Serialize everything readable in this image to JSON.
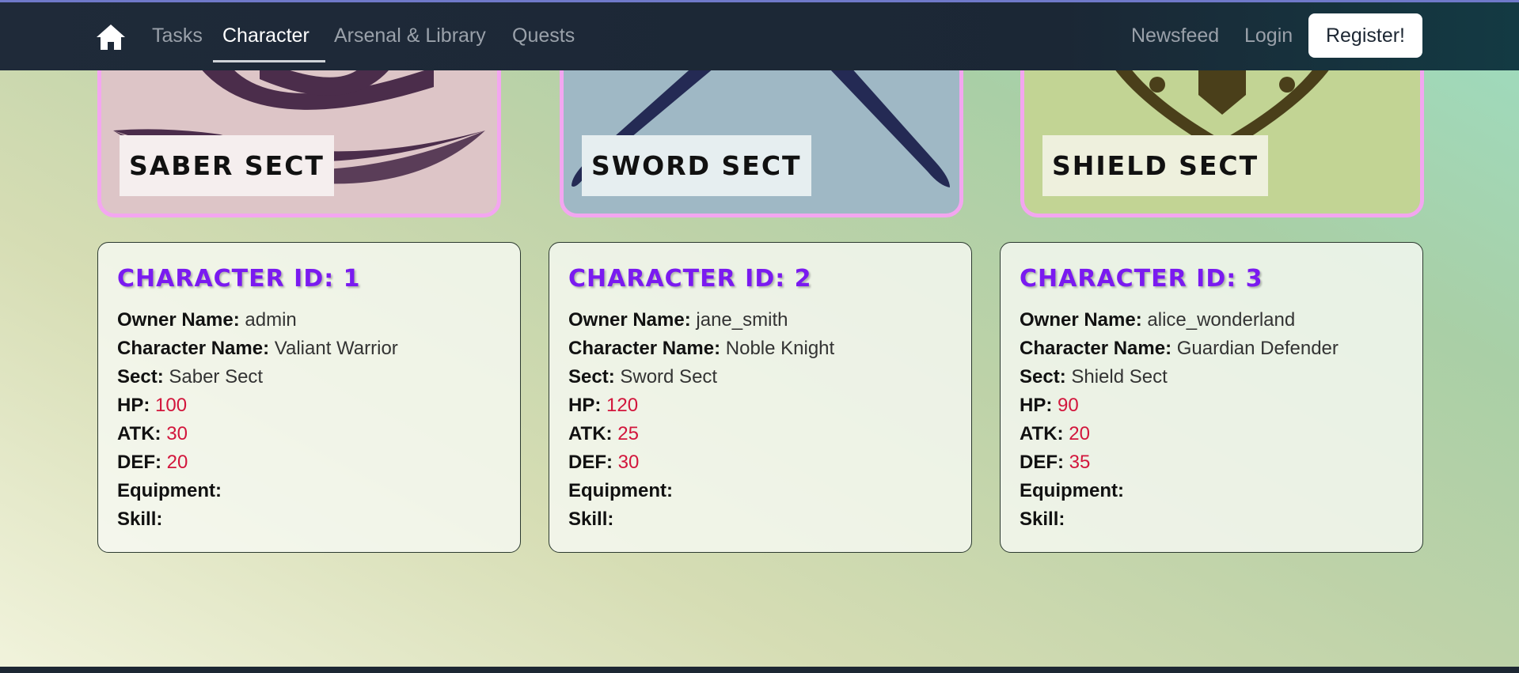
{
  "nav": {
    "home_icon": "home-icon",
    "links": [
      "Tasks",
      "Character",
      "Arsenal & Library",
      "Quests"
    ],
    "active": "Character",
    "right_links": [
      "Newsfeed",
      "Login"
    ],
    "register_label": "Register!"
  },
  "sects": [
    {
      "label": "SABER SECT",
      "icon": "crossed-sabers-icon"
    },
    {
      "label": "SWORD SECT",
      "icon": "crossed-swords-icon"
    },
    {
      "label": "SHIELD SECT",
      "icon": "shield-icon"
    }
  ],
  "characters": [
    {
      "title": "CHARACTER ID: 1",
      "owner_label": "Owner Name:",
      "owner": "admin",
      "name_label": "Character Name:",
      "name": "Valiant Warrior",
      "sect_label": "Sect:",
      "sect": "Saber Sect",
      "hp_label": "HP:",
      "hp": "100",
      "atk_label": "ATK:",
      "atk": "30",
      "def_label": "DEF:",
      "def": "20",
      "equipment_label": "Equipment:",
      "equipment": "",
      "skill_label": "Skill:",
      "skill": ""
    },
    {
      "title": "CHARACTER ID: 2",
      "owner_label": "Owner Name:",
      "owner": "jane_smith",
      "name_label": "Character Name:",
      "name": "Noble Knight",
      "sect_label": "Sect:",
      "sect": "Sword Sect",
      "hp_label": "HP:",
      "hp": "120",
      "atk_label": "ATK:",
      "atk": "25",
      "def_label": "DEF:",
      "def": "30",
      "equipment_label": "Equipment:",
      "equipment": "",
      "skill_label": "Skill:",
      "skill": ""
    },
    {
      "title": "CHARACTER ID: 3",
      "owner_label": "Owner Name:",
      "owner": "alice_wonderland",
      "name_label": "Character Name:",
      "name": "Guardian Defender",
      "sect_label": "Sect:",
      "sect": "Shield Sect",
      "hp_label": "HP:",
      "hp": "90",
      "atk_label": "ATK:",
      "atk": "20",
      "def_label": "DEF:",
      "def": "35",
      "equipment_label": "Equipment:",
      "equipment": "",
      "skill_label": "Skill:",
      "skill": ""
    }
  ],
  "colors": {
    "accent_title": "#7a1af0",
    "stat_value": "#d2163c",
    "card_border": "#f3a6f0",
    "navbar": "#1f2a39"
  }
}
